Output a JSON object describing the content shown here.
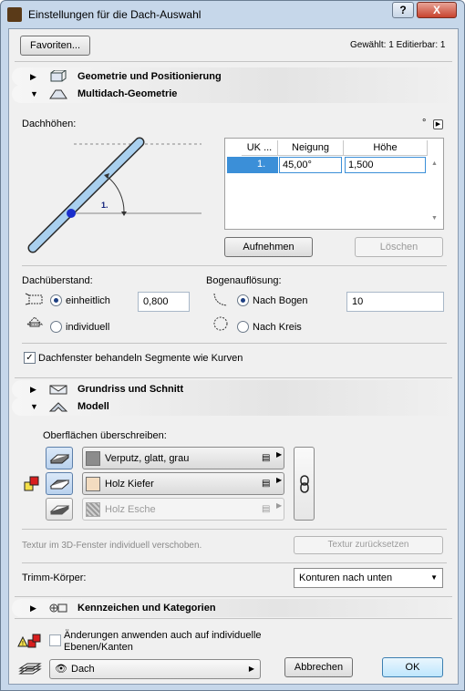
{
  "window": {
    "title": "Einstellungen für die Dach-Auswahl",
    "help": "?",
    "close": "X"
  },
  "header": {
    "favorites": "Favoriten...",
    "selection_info": "Gewählt: 1 Editierbar: 1"
  },
  "sections": {
    "geometry": "Geometrie und Positionierung",
    "multiroof": "Multidach-Geometrie",
    "floorplan": "Grundriss und Schnitt",
    "model": "Modell",
    "tags": "Kennzeichen und Kategorien"
  },
  "roof": {
    "heights_label": "Dachhöhen:",
    "degree_symbol": "°",
    "diagram_label": "1.",
    "table": {
      "columns": [
        "UK ...",
        "Neigung",
        "Höhe"
      ],
      "rows": [
        {
          "uk": "1.",
          "pitch": "45,00°",
          "height": "1,500"
        }
      ]
    },
    "add_button": "Aufnehmen",
    "delete_button": "Löschen",
    "overhang_label": "Dachüberstand:",
    "uniform_label": "einheitlich",
    "uniform_value": "0,800",
    "individual_label": "individuell",
    "arc_label": "Bogenauflösung:",
    "by_arc_label": "Nach Bogen",
    "by_arc_value": "10",
    "by_circle_label": "Nach Kreis",
    "skylight_label": "Dachfenster behandeln Segmente wie Kurven"
  },
  "model": {
    "override_label": "Oberflächen überschreiben:",
    "surfaces": [
      {
        "name": "Verputz, glatt, grau",
        "color": "#8c8c8c"
      },
      {
        "name": "Holz Kiefer",
        "color": "#f3dcc0"
      },
      {
        "name": "Holz Esche",
        "color": "#9a9a9a"
      }
    ],
    "texture_note": "Textur im 3D-Fenster individuell verschoben.",
    "texture_reset": "Textur zurücksetzen",
    "trim_label": "Trimm-Körper:",
    "trim_value": "Konturen nach unten"
  },
  "footer": {
    "apply_label_1": "Änderungen anwenden auch auf individuelle",
    "apply_label_2": "Ebenen/Kanten",
    "layer_value": "Dach",
    "cancel": "Abbrechen",
    "ok": "OK"
  },
  "colors": {
    "accent": "#1e5fbf",
    "selection": "#3b8fd8"
  }
}
